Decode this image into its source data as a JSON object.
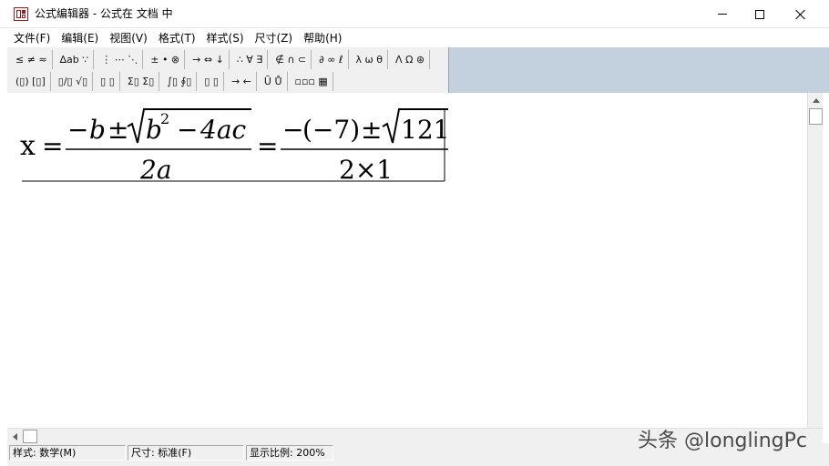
{
  "window": {
    "title": "公式编辑器 - 公式在 文档 中",
    "controls": [
      "minimize",
      "maximize",
      "close"
    ]
  },
  "menu": [
    {
      "label": "文件(F)"
    },
    {
      "label": "编辑(E)"
    },
    {
      "label": "视图(V)"
    },
    {
      "label": "格式(T)"
    },
    {
      "label": "样式(S)"
    },
    {
      "label": "尺寸(Z)"
    },
    {
      "label": "帮助(H)"
    }
  ],
  "palette": {
    "row1": [
      "≤ ≠ ≈",
      "∆ab ∵",
      "⋮ ⋯ ⋱",
      "± • ⊗",
      "→ ⇔ ↓",
      "∴ ∀ ∃",
      "∉ ∩ ⊂",
      "∂ ∞ ℓ",
      "λ ω θ",
      "Λ Ω ⊛"
    ],
    "row2": [
      "(▯) [▯]",
      "▯/▯ √▯",
      "▯ ▯",
      "Σ▯ Σ▯",
      "∫▯ ∮▯",
      "▯ ▯",
      "→ ←",
      "Ū Ů",
      "▫▫▫ ▦"
    ]
  },
  "formula": {
    "lhs": "x",
    "eq": "=",
    "num1": {
      "minus": "−",
      "b": "b",
      "pm": "±",
      "b2": "b",
      "sup": "2",
      "minus2": "−",
      "term": "4ac"
    },
    "den1": "2a",
    "num2": {
      "minus": "−",
      "paren": "(−7)",
      "pm": "±",
      "rad": "121"
    },
    "den2": "2×1"
  },
  "status": {
    "style": "样式: 数学(M)",
    "size": "尺寸: 标准(F)",
    "zoom": "显示比例: 200%"
  },
  "watermark": "头条 @longlingPc"
}
